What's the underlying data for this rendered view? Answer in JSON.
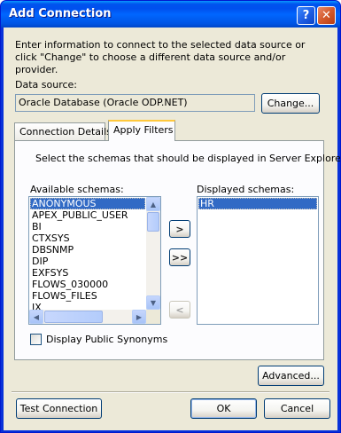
{
  "window": {
    "title": "Add Connection",
    "help_label": "?",
    "close_label": "✕"
  },
  "intro_text": "Enter information to connect to the selected data source or click \"Change\" to choose a different data source and/or provider.",
  "data_source": {
    "label": "Data source:",
    "value": "Oracle Database (Oracle ODP.NET)",
    "change_button": "Change..."
  },
  "tabs": [
    {
      "label": "Connection Details",
      "active": false
    },
    {
      "label": "Apply Filters",
      "active": true
    }
  ],
  "filters": {
    "instruction": "Select the schemas that should be displayed in Server Explorer.",
    "available_label": "Available schemas:",
    "displayed_label": "Displayed schemas:",
    "available_schemas": [
      "ANONYMOUS",
      "APEX_PUBLIC_USER",
      "BI",
      "CTXSYS",
      "DBSNMP",
      "DIP",
      "EXFSYS",
      "FLOWS_030000",
      "FLOWS_FILES",
      "IX"
    ],
    "available_selected": "ANONYMOUS",
    "displayed_schemas": [
      "HR"
    ],
    "displayed_selected": "HR",
    "move_one_label": ">",
    "move_all_label": ">>",
    "move_back_label": "<",
    "public_synonyms_label": "Display Public Synonyms",
    "public_synonyms_checked": false
  },
  "buttons": {
    "advanced": "Advanced...",
    "test_connection": "Test Connection",
    "ok": "OK",
    "cancel": "Cancel"
  },
  "colors": {
    "title_bar": "#0055e5",
    "selection": "#316ac5",
    "dialog_bg": "#ece9d8",
    "active_tab_accent": "#ffc83c"
  }
}
